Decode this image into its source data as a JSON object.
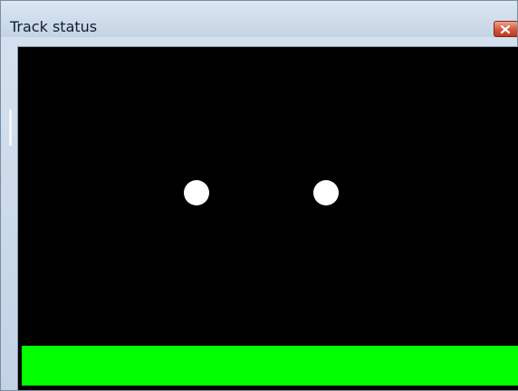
{
  "window": {
    "title": "Track status"
  },
  "icons": {
    "close": "close-icon"
  },
  "track": {
    "background_color": "#000000",
    "markers": [
      {
        "name": "track-marker-1",
        "color": "#ffffff"
      },
      {
        "name": "track-marker-2",
        "color": "#ffffff"
      }
    ],
    "status_bar_color": "#00ff00"
  }
}
